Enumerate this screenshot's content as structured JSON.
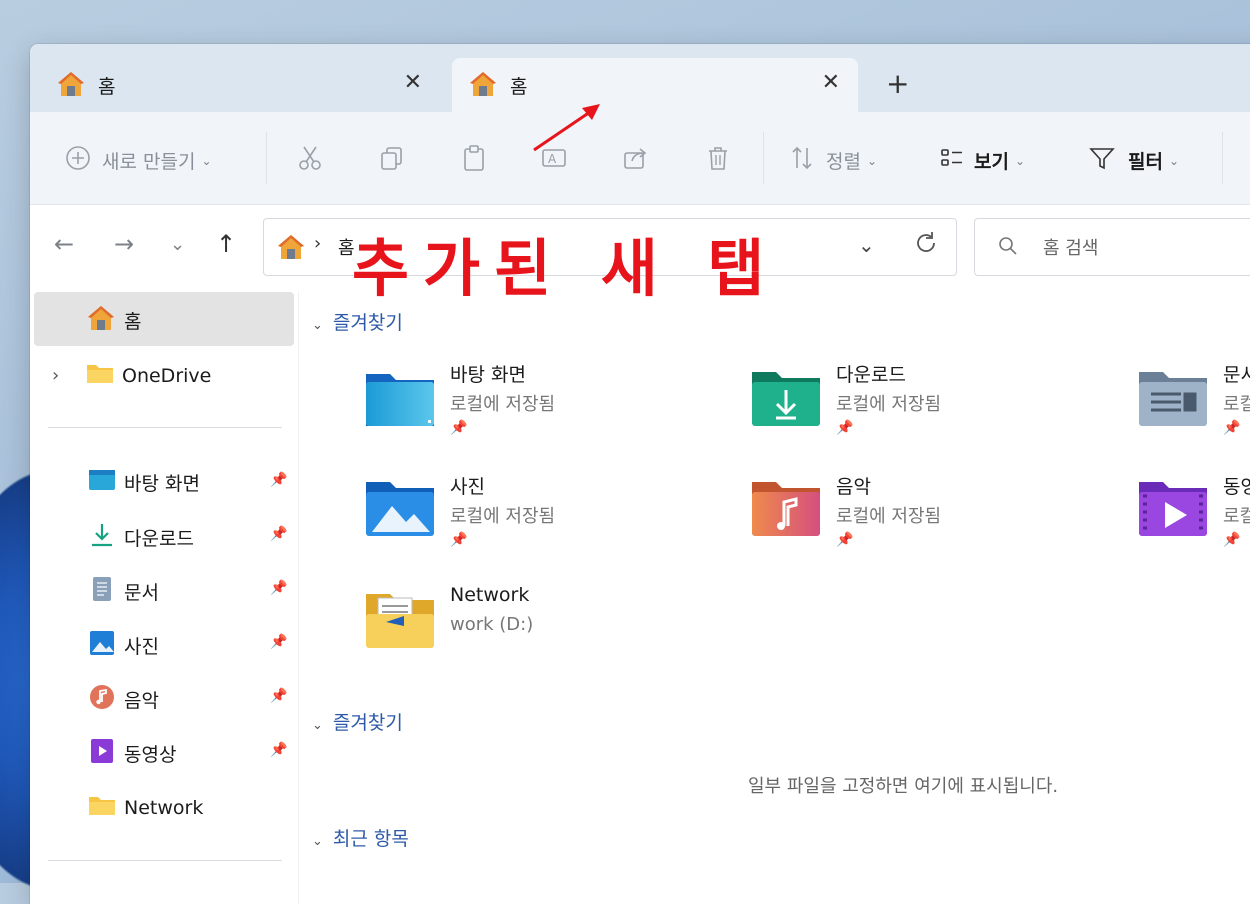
{
  "tabs": [
    {
      "label": "홈",
      "active": false
    },
    {
      "label": "홈",
      "active": true
    }
  ],
  "new_tab": "+",
  "close_glyph": "✕",
  "commandbar": {
    "new_label": "새로 만들기",
    "sort_label": "정렬",
    "view_label": "보기",
    "filter_label": "필터"
  },
  "address": {
    "path_item": "홈",
    "separator": "›"
  },
  "search": {
    "placeholder": "홈 검색"
  },
  "annotation": {
    "text": "추가된 새 탭",
    "color": "#e8141c"
  },
  "sidebar": {
    "home_label": "홈",
    "onedrive_label": "OneDrive",
    "quick": [
      {
        "label": "바탕 화면",
        "icon": "desktop-folder-icon"
      },
      {
        "label": "다운로드",
        "icon": "download-icon"
      },
      {
        "label": "문서",
        "icon": "document-icon"
      },
      {
        "label": "사진",
        "icon": "picture-icon"
      },
      {
        "label": "음악",
        "icon": "music-icon"
      },
      {
        "label": "동영상",
        "icon": "video-icon"
      }
    ],
    "network_label": "Network"
  },
  "main": {
    "favorites_header": "즐겨찾기",
    "tiles": [
      {
        "name": "바탕 화면",
        "sub": "로컬에 저장됨"
      },
      {
        "name": "다운로드",
        "sub": "로컬에 저장됨"
      },
      {
        "name": "문서",
        "sub": "로컬에 저장됨"
      },
      {
        "name": "사진",
        "sub": "로컬에 저장됨"
      },
      {
        "name": "음악",
        "sub": "로컬에 저장됨"
      },
      {
        "name": "동영상",
        "sub": "로컬에 저장됨"
      },
      {
        "name": "Network",
        "sub": "work (D:)"
      }
    ],
    "favorites2_header": "즐겨찾기",
    "empty_message": "일부 파일을 고정하면 여기에 표시됩니다.",
    "recent_header": "최근 항목"
  },
  "colors": {
    "accent": "#2d5aa8",
    "tab_active": "#f1f5f9",
    "tab_strip": "#dbe6f0"
  }
}
